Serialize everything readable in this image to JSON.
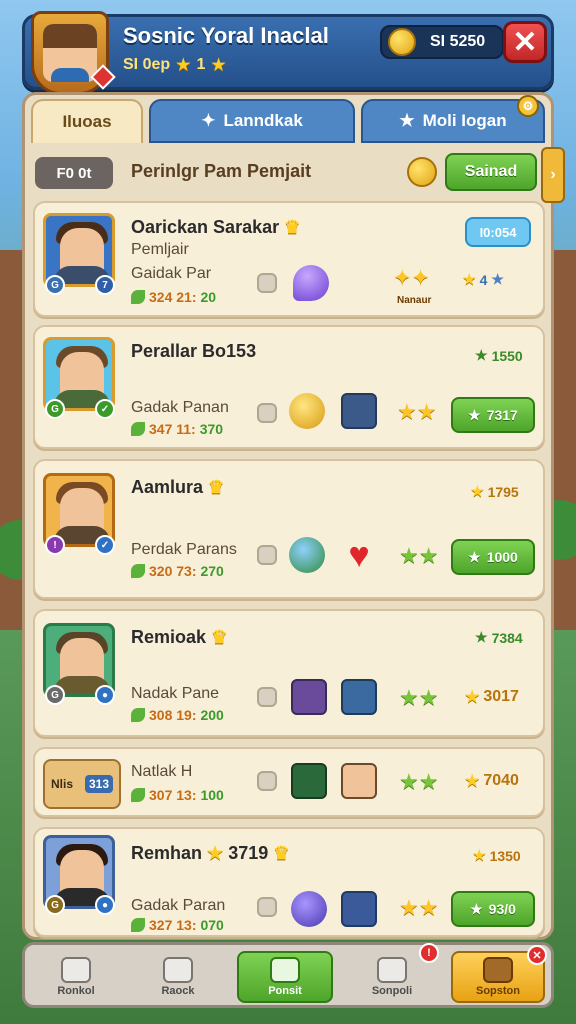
{
  "header": {
    "title": "Sosnic Yoral Inaclal",
    "level": "SI 0ep",
    "stars": "1",
    "currency": "SI 5250",
    "close_symbol": "✕"
  },
  "tabs": [
    {
      "label": "Iluoas"
    },
    {
      "label": "Lanndkak",
      "icon": "sparkle-icon"
    },
    {
      "label": "Moli Iogan",
      "icon": "star-icon"
    }
  ],
  "toolbar": {
    "counter": "F0 0t",
    "title": "Perinlgr Pam Pemjait",
    "save_label": "Sainad",
    "arrow": "›"
  },
  "cards": [
    {
      "name": "Oarickan Sarakar",
      "subtitle": "Pemljair",
      "stat_label": "Gaidak Par",
      "stat": "324 21:",
      "stat2": "20",
      "pill": "I0:054",
      "score": "4",
      "badge": "Nanaur"
    },
    {
      "name": "Perallar Bo153",
      "stat_label": "Gadak Panan",
      "stat": "347 11:",
      "stat2": "370",
      "score": "1550",
      "button": "7317"
    },
    {
      "name": "Aamlura",
      "stat_label": "Perdak Parans",
      "stat": "320 73:",
      "stat2": "270",
      "score": "1795",
      "button": "1000"
    },
    {
      "name": "Remioak",
      "stat_label": "Nadak Pane",
      "stat": "308 19:",
      "stat2": "200",
      "score": "7384",
      "score2": "3017"
    },
    {
      "name": "",
      "stat_label": "Natlak H",
      "stat": "307 13:",
      "stat2": "100",
      "score2": "7040",
      "mini_label": "Nlis",
      "mini_value": "313"
    },
    {
      "name": "Remhan",
      "name_suffix": "3719",
      "stat_label": "Gadak Paran",
      "stat": "327 13:",
      "stat2": "070",
      "score": "1350",
      "button": "93/0"
    }
  ],
  "bottom_nav": [
    {
      "label": "Ronkol",
      "icon": "home-icon"
    },
    {
      "label": "Raock",
      "icon": "calendar-icon"
    },
    {
      "label": "Ponsit",
      "icon": "chest-icon"
    },
    {
      "label": "Sonpoli",
      "icon": "box-icon",
      "badge": "!"
    },
    {
      "label": "Sopston",
      "icon": "treasure-icon",
      "badge": "✕"
    }
  ],
  "colors": {
    "header_blue": "#2a5a98",
    "panel": "#e9ddc4",
    "card": "#f8efd9",
    "green_button": "#4ea52b",
    "gold": "#f0b72e"
  }
}
